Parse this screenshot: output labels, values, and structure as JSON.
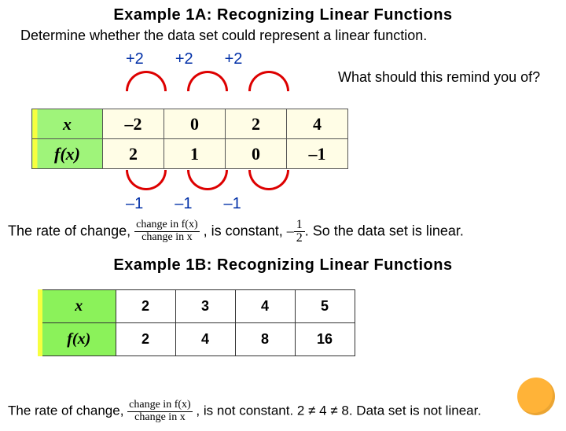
{
  "title1": "Example 1A: Recognizing Linear Functions",
  "prompt": "Determine whether the data set could represent a linear function.",
  "top_deltas": [
    "+2",
    "+2",
    "+2"
  ],
  "side_note": "What should this remind you of?",
  "table1": {
    "row_x_label": "x",
    "row_fx_label": "f(x)",
    "x": [
      "–2",
      "0",
      "2",
      "4"
    ],
    "fx": [
      "2",
      "1",
      "0",
      "–1"
    ]
  },
  "bot_deltas": [
    "–1",
    "–1",
    "–1"
  ],
  "sentence1": {
    "pre": "The rate of change, ",
    "mid": ", is constant, ",
    "post": " So the data set is linear.",
    "frac_top": "change in f(x)",
    "frac_bot": "change in x",
    "neg": "–",
    "k_top": "1",
    "k_bot": "2",
    "k_end": "."
  },
  "title2": "Example 1B: Recognizing Linear Functions",
  "table2": {
    "row_x_label": "x",
    "row_fx_label": "f(x)",
    "x": [
      "2",
      "3",
      "4",
      "5"
    ],
    "fx": [
      "2",
      "4",
      "8",
      "16"
    ]
  },
  "sentence2": {
    "pre": "The rate of change, ",
    "post": ", is not constant.  2 ≠ 4 ≠ 8. Data set is not linear.",
    "frac_top": "change in f(x)",
    "frac_bot": "change in x"
  },
  "chart_data": [
    {
      "type": "table",
      "title": "Example 1A data",
      "columns": [
        "x",
        "f(x)"
      ],
      "rows": [
        [
          -2,
          2
        ],
        [
          0,
          1
        ],
        [
          2,
          0
        ],
        [
          4,
          -1
        ]
      ],
      "dx": [
        2,
        2,
        2
      ],
      "dfx": [
        -1,
        -1,
        -1
      ],
      "constant_rate": -0.5,
      "is_linear": true
    },
    {
      "type": "table",
      "title": "Example 1B data",
      "columns": [
        "x",
        "f(x)"
      ],
      "rows": [
        [
          2,
          2
        ],
        [
          3,
          4
        ],
        [
          4,
          8
        ],
        [
          5,
          16
        ]
      ],
      "dfx": [
        2,
        4,
        8
      ],
      "is_linear": false
    }
  ]
}
